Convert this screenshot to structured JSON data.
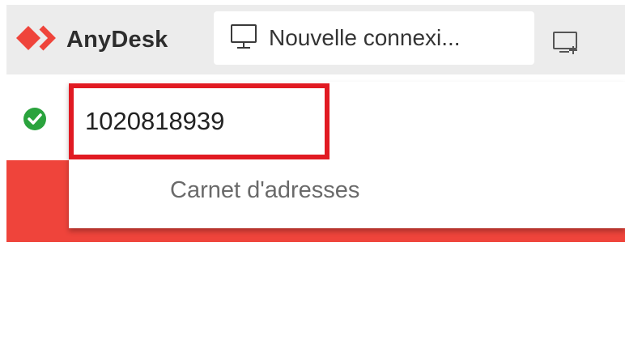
{
  "app": {
    "name": "AnyDesk",
    "brand_color": "#ef443b",
    "logo_icon": "anydesk-logo-icon"
  },
  "tabs": [
    {
      "label": "Nouvelle connexi...",
      "icon": "monitor-icon"
    }
  ],
  "new_tab_icon": "new-connection-icon",
  "connection_status": {
    "icon": "check-circle-icon",
    "color": "#2aa33d"
  },
  "address_bar": {
    "value": "1020818939",
    "highlight_color": "#e11a22"
  },
  "suggestions": [
    {
      "label": "Carnet d'adresses"
    }
  ]
}
